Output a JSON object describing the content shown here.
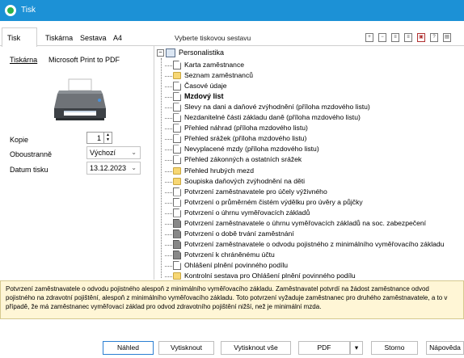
{
  "window": {
    "title": "Tisk",
    "accent": "#1c91d6"
  },
  "tabs": [
    {
      "label": "Tisk"
    },
    {
      "label": "Tiskárna"
    },
    {
      "label": "Sestava"
    },
    {
      "label": "A4"
    }
  ],
  "header": {
    "select_label": "Vyberte tiskovou sestavu"
  },
  "toolbar": {
    "icons": [
      "expand-icon",
      "collapse-icon",
      "document-icon",
      "document-icon",
      "pdf-icon",
      "help-icon",
      "document-icon"
    ]
  },
  "left": {
    "printer_label": "Tiskárna",
    "printer_name": "Microsoft Print to PDF",
    "copies_label": "Kopie",
    "copies_value": "1",
    "duplex_label": "Oboustranně",
    "duplex_value": "Výchozí",
    "date_label": "Datum tisku",
    "date_value": "13.12.2023"
  },
  "tree": {
    "root": "Personalistika",
    "items": [
      {
        "label": "Karta zaměstnance",
        "icon": "doc",
        "bold": false
      },
      {
        "label": "Seznam zaměstnanců",
        "icon": "folder",
        "bold": false
      },
      {
        "label": "Časové údaje",
        "icon": "doc",
        "bold": false
      },
      {
        "label": "Mzdový list",
        "icon": "doc",
        "bold": true
      },
      {
        "label": "Slevy na dani a daňové zvýhodnění (příloha mzdového listu)",
        "icon": "doc",
        "bold": false
      },
      {
        "label": "Nezdanitelné části základu daně (příloha mzdového listu)",
        "icon": "doc",
        "bold": false
      },
      {
        "label": "Přehled náhrad (příloha mzdového listu)",
        "icon": "doc",
        "bold": false
      },
      {
        "label": "Přehled srážek (příloha mzdového listu)",
        "icon": "doc",
        "bold": false
      },
      {
        "label": "Nevyplacené mzdy (příloha mzdového listu)",
        "icon": "doc",
        "bold": false
      },
      {
        "label": "Přehled zákonných a ostatních srážek",
        "icon": "doc",
        "bold": false
      },
      {
        "label": "Přehled hrubých mezd",
        "icon": "folder",
        "bold": false
      },
      {
        "label": "Soupiska daňových zvýhodnění na děti",
        "icon": "folder",
        "bold": false
      },
      {
        "label": "Potvrzení zaměstnavatele pro účely výživného",
        "icon": "doc",
        "bold": false
      },
      {
        "label": "Potvrzení o průměrném čistém výdělku pro úvěry a půjčky",
        "icon": "doc",
        "bold": false
      },
      {
        "label": "Potvrzení o úhrnu vyměřovacích základů",
        "icon": "doc",
        "bold": false
      },
      {
        "label": "Potvrzení zaměstnavatele o úhrnu vyměřovacích základů na soc. zabezpečení",
        "icon": "dark",
        "bold": false
      },
      {
        "label": "Potvrzení o době trvání zaměstnání",
        "icon": "dark",
        "bold": false
      },
      {
        "label": "Potvrzení zaměstnavatele o odvodu pojistného z minimálního vyměřovacího základu",
        "icon": "dark",
        "bold": false
      },
      {
        "label": "Potvrzení k chráněnému účtu",
        "icon": "dark",
        "bold": false
      },
      {
        "label": "Ohlášení plnění povinného podílu",
        "icon": "doc",
        "bold": false
      },
      {
        "label": "Kontrolní sestava pro Ohlášení plnění povinného podílu",
        "icon": "folder",
        "bold": false
      }
    ]
  },
  "description": "Potvrzení zaměstnavatele o odvodu pojistného alespoň z minimálního vyměřovacího základu. Zaměstnavatel potvrdí na žádost zaměstnance odvod pojistného na zdravotní pojištění, alespoň z minimálního vyměřovacího základu. Toto potvrzení vyžaduje zaměstnanec pro druhého zaměstnavatele, a to v případě, že má zaměstnanec vyměřovací základ pro odvod zdravotního pojištění nižší, než je minimální mzda.",
  "buttons": {
    "preview": "Náhled",
    "print": "Vytisknout",
    "print_all": "Vytisknout vše",
    "pdf": "PDF",
    "cancel": "Storno",
    "help": "Nápověda"
  }
}
